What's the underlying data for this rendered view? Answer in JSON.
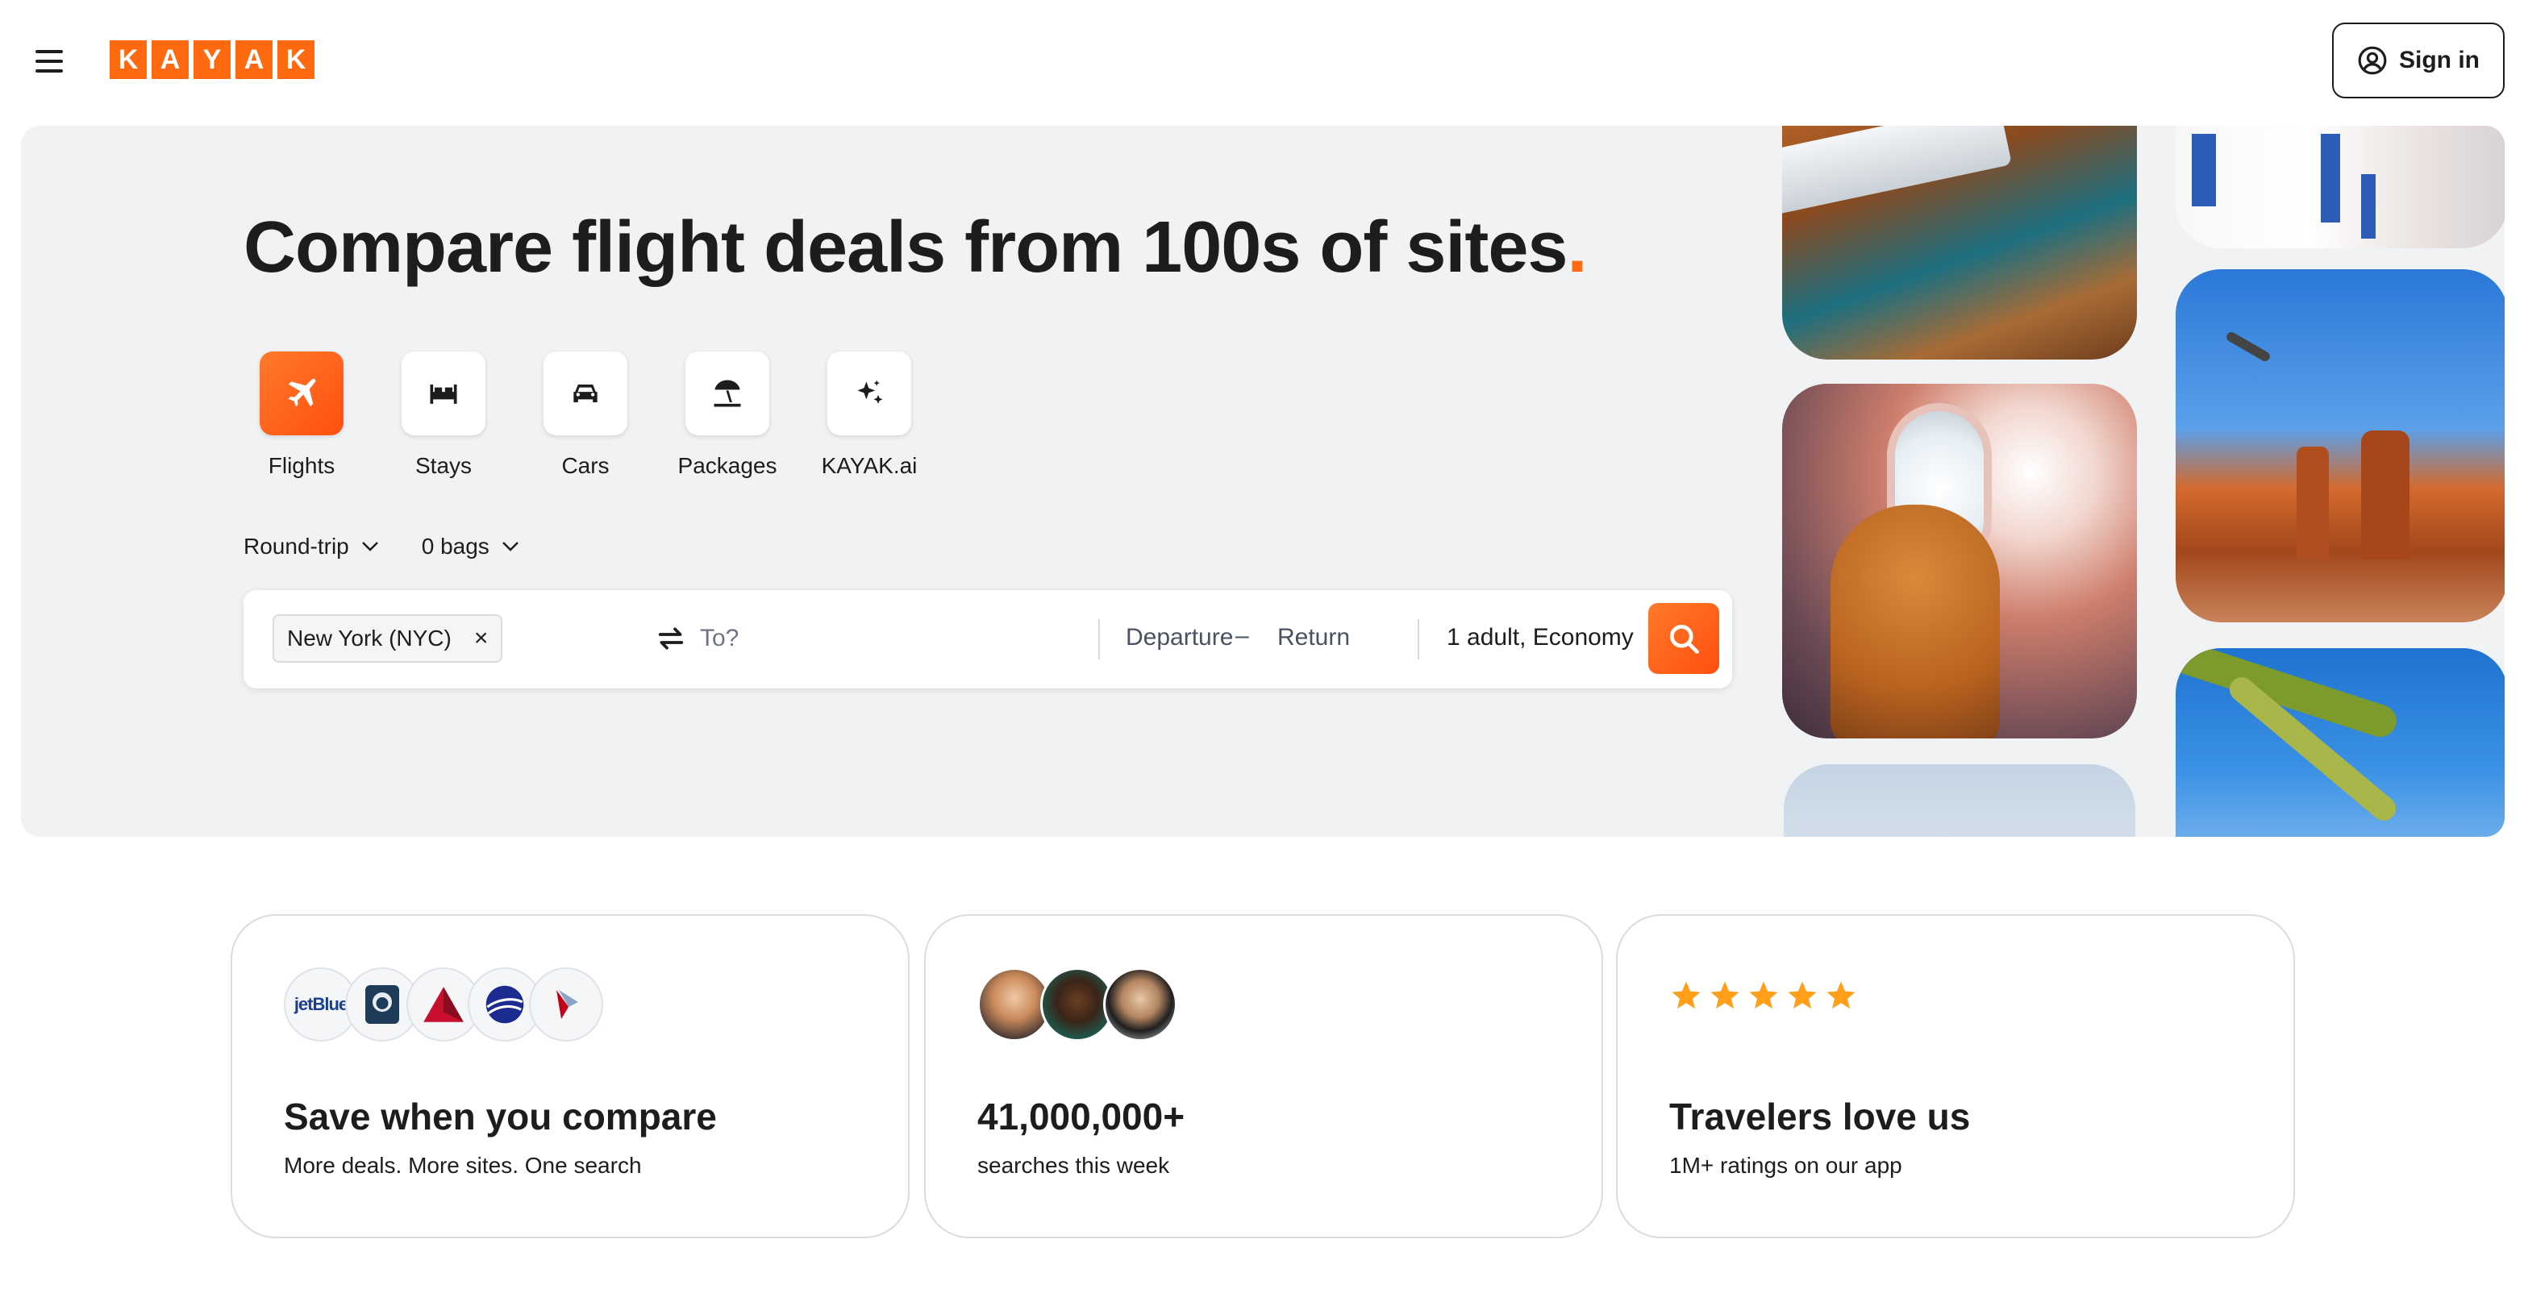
{
  "header": {
    "menu_icon": "hamburger-menu-icon",
    "logo_letters": [
      "K",
      "A",
      "Y",
      "A",
      "K"
    ],
    "signin_label": "Sign in",
    "signin_icon": "user-circle-icon",
    "brand_color": "#ff690f"
  },
  "hero": {
    "title": "Compare flight deals from 100s of sites",
    "title_dot": ".",
    "verticals": [
      {
        "label": "Flights",
        "icon": "plane-icon",
        "active": true
      },
      {
        "label": "Stays",
        "icon": "bed-icon",
        "active": false
      },
      {
        "label": "Cars",
        "icon": "car-icon",
        "active": false
      },
      {
        "label": "Packages",
        "icon": "beach-umbrella-icon",
        "active": false
      },
      {
        "label": "KAYAK.ai",
        "icon": "sparkle-icon",
        "active": false
      }
    ],
    "trip_type": "Round-trip",
    "bags": "0 bags"
  },
  "search": {
    "origin": "New York (NYC)",
    "origin_remove": "×",
    "destination_placeholder": "To?",
    "departure": "Departure",
    "date_separator": "–",
    "return": "Return",
    "travelers": "1 adult, Economy",
    "search_icon": "search-icon"
  },
  "cards": [
    {
      "title": "Save when you compare",
      "subtitle": "More deals. More sites. One search",
      "airline_logo_text": "jetBlue"
    },
    {
      "title": "41,000,000+",
      "subtitle": "searches this week"
    },
    {
      "title": "Travelers love us",
      "subtitle": "1M+ ratings on our app",
      "rating_stars": 5,
      "star_color": "#ff9f1a"
    }
  ]
}
